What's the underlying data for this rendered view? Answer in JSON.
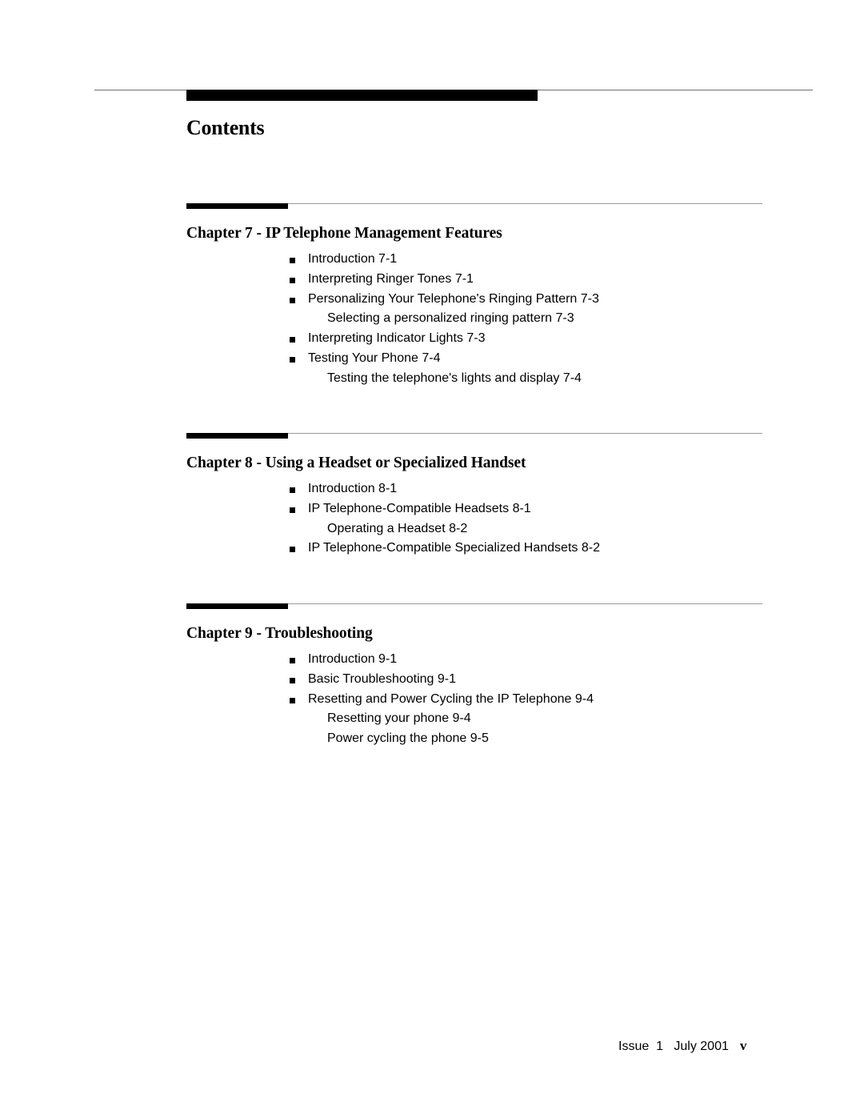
{
  "page": {
    "title": "Contents"
  },
  "chapters": [
    {
      "title": "Chapter 7 - IP Telephone Management Features",
      "entries": [
        {
          "level": 1,
          "text": "Introduction 7-1"
        },
        {
          "level": 1,
          "text": "Interpreting Ringer Tones 7-1"
        },
        {
          "level": 1,
          "text": "Personalizing Your Telephone's Ringing Pattern 7-3"
        },
        {
          "level": 2,
          "text": "Selecting a personalized ringing pattern 7-3"
        },
        {
          "level": 1,
          "text": "Interpreting Indicator Lights 7-3"
        },
        {
          "level": 1,
          "text": "Testing Your Phone 7-4"
        },
        {
          "level": 2,
          "text": "Testing the telephone's lights and display 7-4"
        }
      ]
    },
    {
      "title": "Chapter 8 - Using a Headset or Specialized Handset",
      "entries": [
        {
          "level": 1,
          "text": "Introduction 8-1"
        },
        {
          "level": 1,
          "text": "IP Telephone-Compatible Headsets 8-1"
        },
        {
          "level": 2,
          "text": "Operating a Headset 8-2"
        },
        {
          "level": 1,
          "text": "IP Telephone-Compatible Specialized Handsets 8-2"
        }
      ]
    },
    {
      "title": "Chapter 9 - Troubleshooting",
      "entries": [
        {
          "level": 1,
          "text": "Introduction 9-1"
        },
        {
          "level": 1,
          "text": "Basic Troubleshooting 9-1"
        },
        {
          "level": 1,
          "text": "Resetting and Power Cycling the IP Telephone 9-4"
        },
        {
          "level": 2,
          "text": "Resetting your phone 9-4"
        },
        {
          "level": 2,
          "text": "Power cycling the phone 9-5"
        }
      ]
    }
  ],
  "footer": {
    "issue": "Issue  1   July 2001",
    "page_number": "v"
  }
}
